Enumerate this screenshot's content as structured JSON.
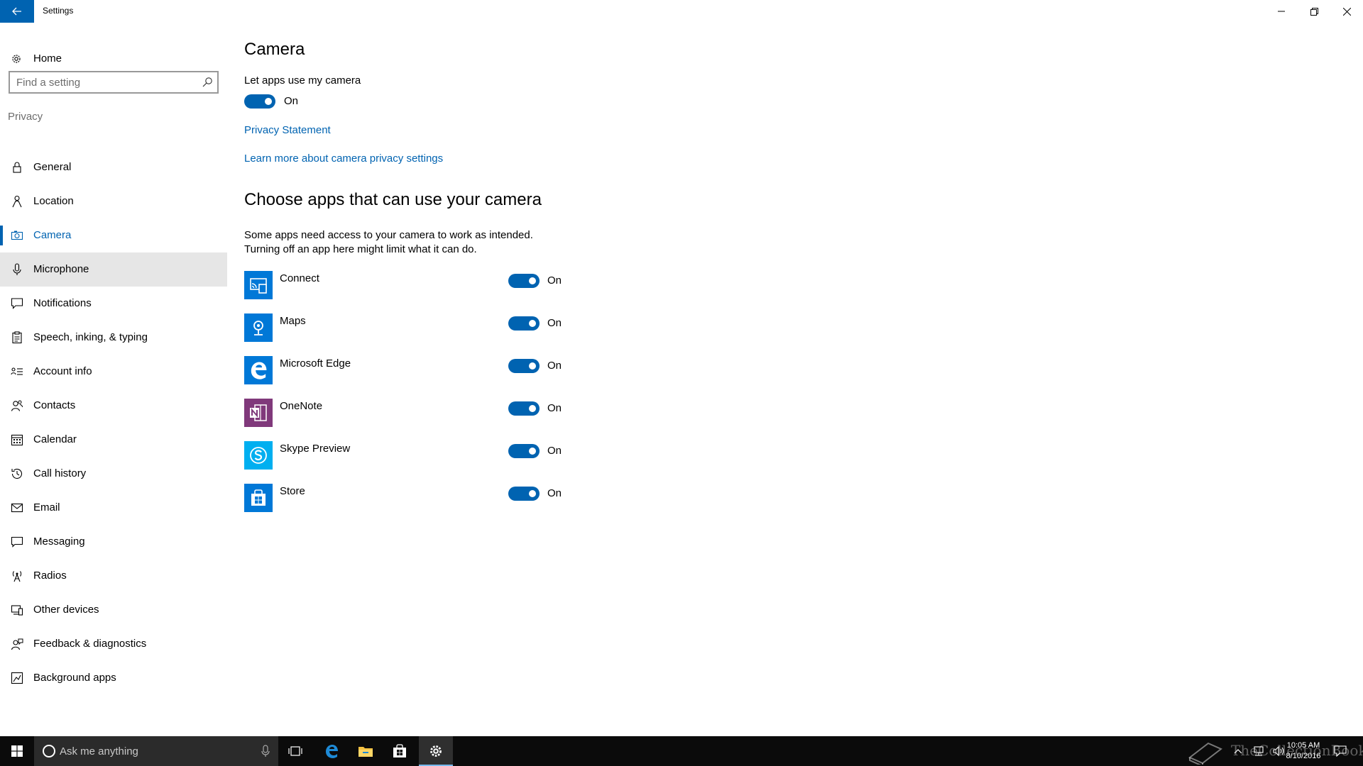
{
  "window": {
    "title": "Settings",
    "back_icon": "arrow-left-icon"
  },
  "sidebar": {
    "home_label": "Home",
    "search_placeholder": "Find a setting",
    "section_label": "Privacy",
    "items": [
      {
        "label": "General",
        "icon": "lock-icon"
      },
      {
        "label": "Location",
        "icon": "location-person-icon"
      },
      {
        "label": "Camera",
        "icon": "camera-icon"
      },
      {
        "label": "Microphone",
        "icon": "microphone-icon"
      },
      {
        "label": "Notifications",
        "icon": "notification-icon"
      },
      {
        "label": "Speech, inking, & typing",
        "icon": "clipboard-icon"
      },
      {
        "label": "Account info",
        "icon": "account-info-icon"
      },
      {
        "label": "Contacts",
        "icon": "contacts-icon"
      },
      {
        "label": "Calendar",
        "icon": "calendar-icon"
      },
      {
        "label": "Call history",
        "icon": "history-icon"
      },
      {
        "label": "Email",
        "icon": "mail-icon"
      },
      {
        "label": "Messaging",
        "icon": "message-icon"
      },
      {
        "label": "Radios",
        "icon": "radio-tower-icon"
      },
      {
        "label": "Other devices",
        "icon": "devices-icon"
      },
      {
        "label": "Feedback & diagnostics",
        "icon": "feedback-icon"
      },
      {
        "label": "Background apps",
        "icon": "background-apps-icon"
      }
    ],
    "active_index": 2,
    "hover_index": 3
  },
  "main": {
    "title": "Camera",
    "master_label": "Let apps use my camera",
    "master_state": "On",
    "privacy_link": "Privacy Statement",
    "learn_link": "Learn more about camera privacy settings",
    "choose_heading": "Choose apps that can use your camera",
    "description_line1": "Some apps need access to your camera to work as intended.",
    "description_line2": "Turning off an app here might limit what it can do.",
    "apps": [
      {
        "name": "Connect",
        "state": "On",
        "icon": "connect-app-icon",
        "color": "#0078d7"
      },
      {
        "name": "Maps",
        "state": "On",
        "icon": "maps-app-icon",
        "color": "#0078d7"
      },
      {
        "name": "Microsoft Edge",
        "state": "On",
        "icon": "edge-app-icon",
        "color": "#0078d7"
      },
      {
        "name": "OneNote",
        "state": "On",
        "icon": "onenote-app-icon",
        "color": "#80397b"
      },
      {
        "name": "Skype Preview",
        "state": "On",
        "icon": "skype-app-icon",
        "color": "#00aff0"
      },
      {
        "name": "Store",
        "state": "On",
        "icon": "store-app-icon",
        "color": "#0078d7"
      }
    ]
  },
  "taskbar": {
    "search_placeholder": "Ask me anything",
    "time": "10:05 AM",
    "date": "8/10/2016",
    "watermark": "TheCollectionBook"
  },
  "colors": {
    "accent": "#0063b1",
    "toggle_on": "#0063b1",
    "hover_bg": "#e6e6e6",
    "taskbar_bg": "#0b0b0b"
  }
}
